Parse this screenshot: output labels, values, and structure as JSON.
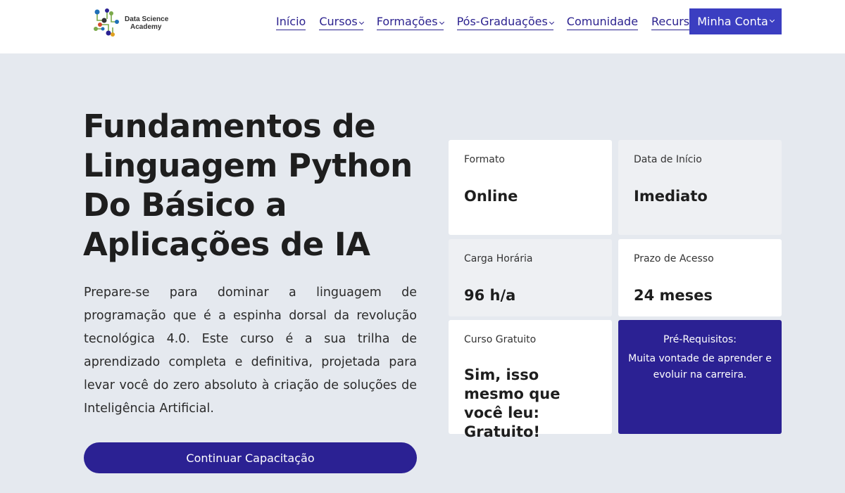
{
  "logo": {
    "line1": "Data Science",
    "line2": "Academy"
  },
  "nav": {
    "items": [
      {
        "label": "Início",
        "has_menu": false
      },
      {
        "label": "Cursos",
        "has_menu": true
      },
      {
        "label": "Formações",
        "has_menu": true
      },
      {
        "label": "Pós-Graduações",
        "has_menu": true
      },
      {
        "label": "Comunidade",
        "has_menu": false
      },
      {
        "label": "Recursos",
        "has_menu": true
      }
    ],
    "account_label": "Minha Conta"
  },
  "hero": {
    "title_lines": [
      "Fundamentos de",
      "Linguagem Python",
      "Do Básico a",
      "Aplicações de IA"
    ],
    "description": "Prepare-se para dominar a linguagem de programação que é a espinha dorsal da revolução tecnológica 4.0. Este curso é a sua trilha de aprendizado completa e definitiva, projetada para levar você do zero absoluto à criação de soluções de Inteligência Artificial.",
    "cta_label": "Continuar Capacitação"
  },
  "info_cards": {
    "format": {
      "label": "Formato",
      "value": "Online"
    },
    "start": {
      "label": "Data de Início",
      "value": "Imediato"
    },
    "hours": {
      "label": "Carga Horária",
      "value": "96 h/a"
    },
    "access": {
      "label": "Prazo de Acesso",
      "value": "24 meses"
    },
    "free": {
      "label": "Curso Gratuito",
      "value": "Sim, isso mesmo que você leu: Gratuito!"
    },
    "prereq": {
      "title": "Pré-Requisitos:",
      "text": "Muita vontade de aprender e evoluir na carreira."
    }
  },
  "colors": {
    "brand": "#2b2193",
    "account_button": "#3b3ec1",
    "hero_background": "#e5e9ef"
  }
}
